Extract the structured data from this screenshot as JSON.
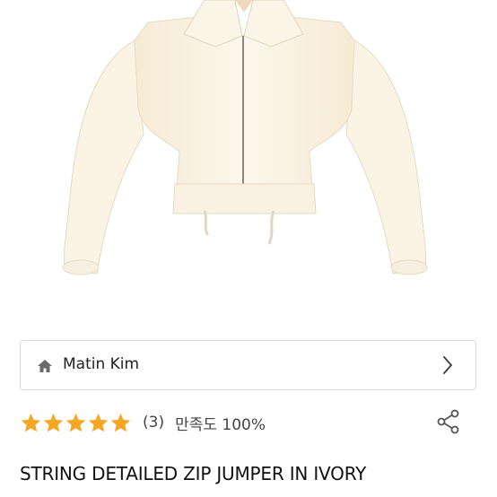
{
  "brand": {
    "name": "Matin Kim"
  },
  "rating": {
    "stars": 5,
    "max_stars": 5,
    "count": "(3)",
    "satisfaction": "만족도 100%"
  },
  "product": {
    "title": "STRING DETAILED ZIP JUMPER IN IVORY"
  },
  "colors": {
    "star": "#f5a623",
    "jacket": "#faf3e2"
  },
  "icons": [
    "home-icon",
    "chevron-right-icon",
    "star-icon",
    "share-icon"
  ]
}
